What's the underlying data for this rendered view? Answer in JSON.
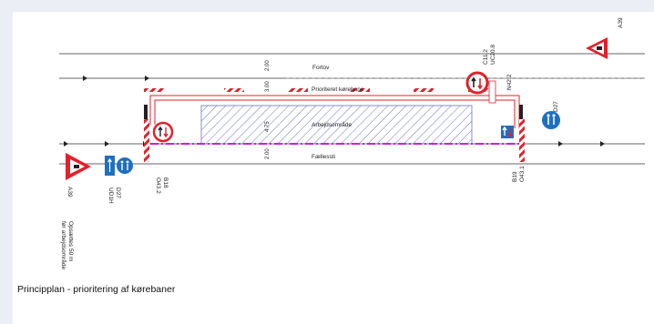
{
  "caption": "Principplan - prioritering af kørebaner",
  "lanes": {
    "sidewalk": "Fortov",
    "priority_lane": "Prioriteret kørebane",
    "work_area": "Arbejdsområde",
    "shared_path": "Fællessti"
  },
  "dimensions": {
    "sidewalk_width": "2.00",
    "lane_width": "3.00",
    "work_width": "4.75",
    "path_width": "2.00"
  },
  "sign_codes": {
    "a39_right": "A39",
    "c11_2": "C11.2",
    "uc20_8": "UC20.8",
    "n42_2": "N42.2",
    "d27_right": "D27",
    "b19": "B19",
    "o43_1": "O43.1",
    "b18": "B18",
    "o43_2": "O43.2",
    "a39_left": "A39",
    "d27_left": "D27",
    "ud1h": "UD1H"
  },
  "note_lines": [
    "Opsættes 50 m",
    "før arbejdsområde"
  ],
  "colors": {
    "red": "#e3202b",
    "hatch": "#6b73c8",
    "magenta": "#cc22cc",
    "blue_sign": "#1e6fc0"
  },
  "icons": [
    "warning-triangle-icon",
    "no-entry-icon",
    "give-way-oncoming-icon",
    "priority-oncoming-icon",
    "shared-path-icon",
    "cycle-sign-icon"
  ]
}
